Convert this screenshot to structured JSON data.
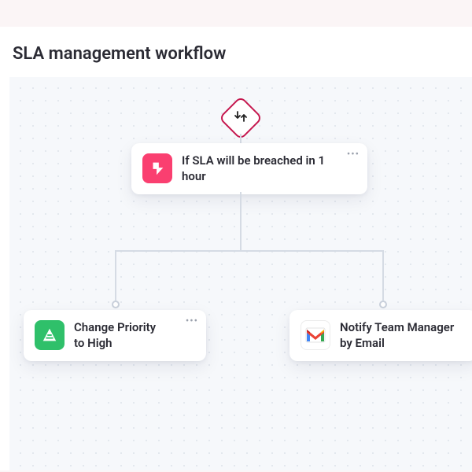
{
  "workflow": {
    "title": "SLA management workflow",
    "condition": {
      "label": "If SLA will be breached in 1 hour",
      "icon": "sla-icon"
    },
    "actions": {
      "left": {
        "label_line1": "Change Priority",
        "label_line2": "to High",
        "icon": "priority-icon"
      },
      "right": {
        "label_line1": "Notify Team Manager",
        "label_line2": "by Email",
        "icon": "gmail-icon"
      }
    }
  },
  "colors": {
    "accent_pink": "#fa3f70",
    "accent_green": "#2fc06a",
    "diamond_border": "#c5174e",
    "canvas_bg": "#f6f8fb"
  }
}
